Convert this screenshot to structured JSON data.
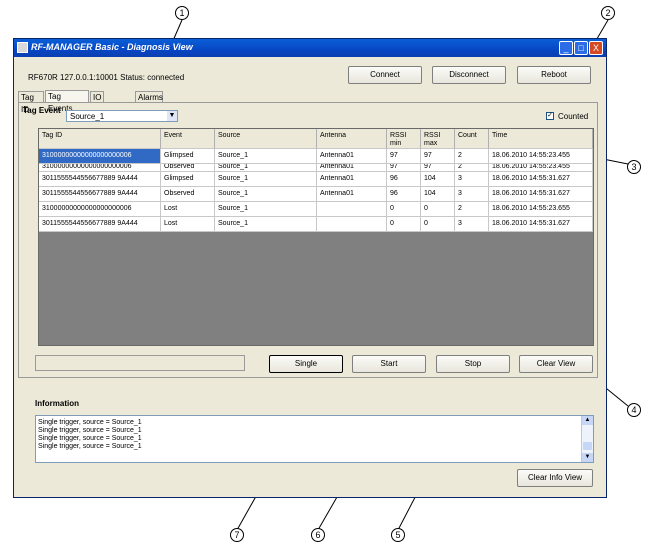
{
  "window": {
    "title": "RF-MANAGER Basic - Diagnosis View",
    "controls": {
      "minimize": "_",
      "maximize": "□",
      "close": "X"
    }
  },
  "status": {
    "device": "RF670R",
    "address": "127.0.0.1:10001",
    "status_label": "Status:",
    "status_value": "connected"
  },
  "toolbar": {
    "connect": "Connect",
    "disconnect": "Disconnect",
    "reboot": "Reboot"
  },
  "tabs": [
    "Tag ID",
    "Tag Events",
    "IO",
    "Alarms"
  ],
  "tag_event": {
    "label": "Tag Event",
    "source_selected": "Source_1",
    "counted_label": "Counted",
    "counted_checked": true
  },
  "table": {
    "columns": [
      "Tag ID",
      "Event",
      "Source",
      "Antenna",
      "RSSI min",
      "RSSI max",
      "Count",
      "Time"
    ],
    "rows": [
      [
        "31000000000000000000006",
        "Glimpsed",
        "Source_1",
        "Antenna01",
        "97",
        "97",
        "2",
        "18.06.2010 14:55:23.455"
      ],
      [
        "31000000000000000000006",
        "Observed",
        "Source_1",
        "Antenna01",
        "97",
        "97",
        "2",
        "18.06.2010 14:55:23.455"
      ],
      [
        "3011555544556677889 9A444",
        "Glimpsed",
        "Source_1",
        "Antenna01",
        "96",
        "104",
        "3",
        "18.06.2010 14:55:31.627"
      ],
      [
        "3011555544556677889 9A444",
        "Observed",
        "Source_1",
        "Antenna01",
        "96",
        "104",
        "3",
        "18.06.2010 14:55:31.627"
      ],
      [
        "31000000000000000000006",
        "Lost",
        "Source_1",
        "",
        "0",
        "0",
        "2",
        "18.06.2010 14:55:23.655"
      ],
      [
        "3011555544556677889 9A444",
        "Lost",
        "Source_1",
        "",
        "0",
        "0",
        "3",
        "18.06.2010 14:55:31.627"
      ]
    ]
  },
  "actions": {
    "single": "Single",
    "start": "Start",
    "stop": "Stop",
    "clear_view": "Clear View"
  },
  "information": {
    "title": "Information",
    "lines": [
      "Single trigger, source = Source_1",
      "Single trigger, source = Source_1",
      "Single trigger, source = Source_1",
      "Single trigger, source = Source_1"
    ],
    "clear_info": "Clear Info View"
  },
  "callouts": [
    "1",
    "2",
    "3",
    "4",
    "5",
    "6",
    "7"
  ],
  "colors": {
    "title_blue": "#0a5fd8",
    "selection": "#316ac5",
    "grid_bg": "#808080"
  }
}
